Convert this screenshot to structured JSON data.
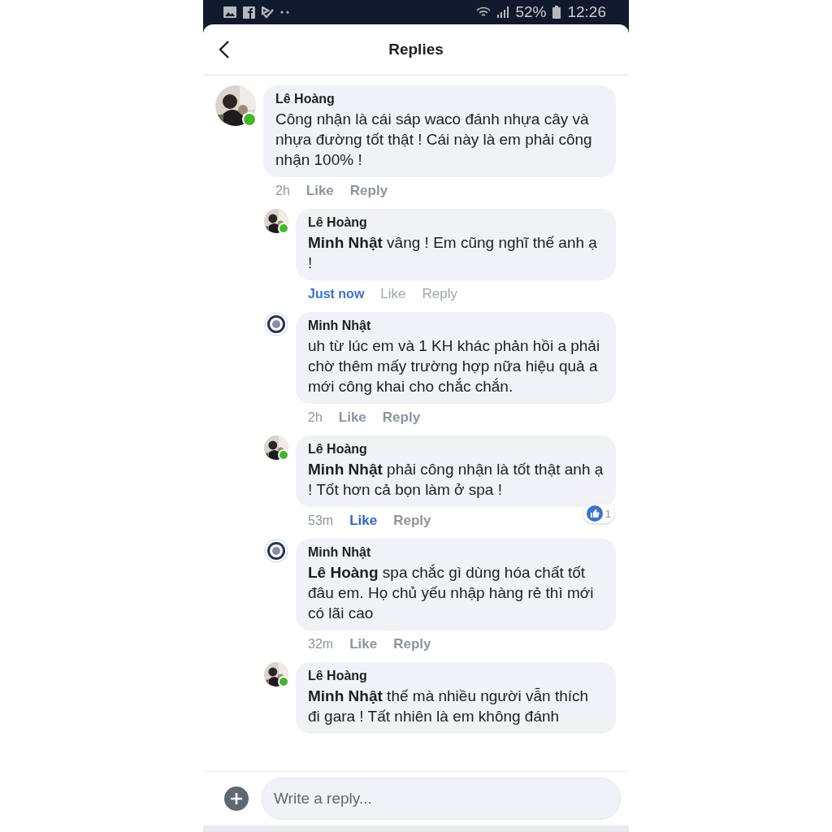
{
  "status_bar": {
    "battery": "52%",
    "time": "12:26"
  },
  "header": {
    "title": "Replies"
  },
  "comment": {
    "author": "Lê Hoàng",
    "online": true,
    "text": "Công nhận là cái sáp waco đánh nhựa cây và nhựa đường tốt thật ! Cái này là em phải công nhận 100% !",
    "time": "2h",
    "fresh": false,
    "liked": false,
    "actions": [
      "Like",
      "Reply"
    ]
  },
  "replies": [
    {
      "author": "Lê Hoàng",
      "online": true,
      "text": "**Minh Nhật** vâng ! Em cũng nghĩ thế anh ạ !",
      "time": "Just now",
      "fresh": true,
      "liked": false,
      "actions": [
        "Like",
        "Reply"
      ]
    },
    {
      "author": "Minh Nhật",
      "kind": "emblem",
      "online": false,
      "text": "uh từ lúc em và 1 KH khác phản hồi a phải chờ thêm mấy trường hợp nữa hiệu quả a mới công khai cho chắc chắn.",
      "time": "2h",
      "fresh": false,
      "liked": false,
      "actions": [
        "Like",
        "Reply"
      ]
    },
    {
      "author": "Lê Hoàng",
      "online": true,
      "text": "**Minh Nhật** phải công nhận là tốt thật anh ạ ! Tốt hơn cả bọn làm ở spa !",
      "time": "53m",
      "fresh": false,
      "liked": true,
      "reactions": "1",
      "actions": [
        "Like",
        "Reply"
      ]
    },
    {
      "author": "Minh Nhật",
      "kind": "emblem",
      "online": false,
      "text": "**Lê Hoàng** spa chắc gì dùng hóa chất tốt đâu em. Họ chủ yếu nhập hàng rẻ thì mới có lãi cao",
      "time": "32m",
      "fresh": false,
      "liked": false,
      "actions": [
        "Like",
        "Reply"
      ]
    },
    {
      "author": "Lê Hoàng",
      "online": true,
      "text": "**Minh Nhật** thế mà nhiều người vẫn thích đi gara ! Tất nhiên là em không đánh"
    }
  ],
  "composer": {
    "placeholder": "Write a reply..."
  }
}
